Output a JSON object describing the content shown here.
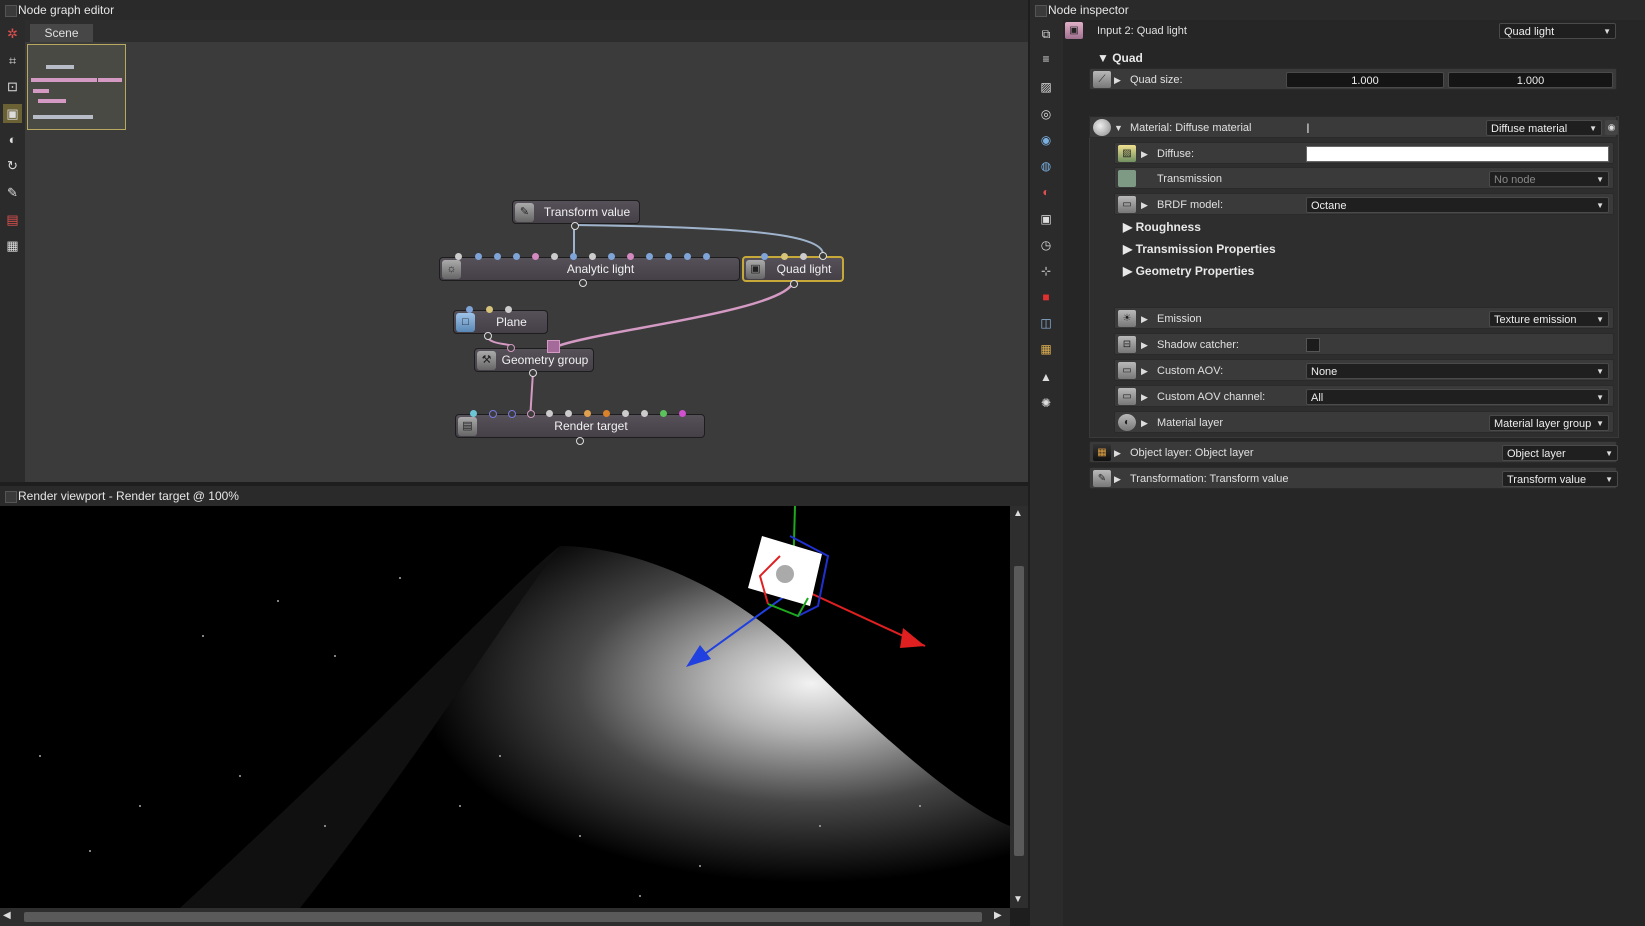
{
  "node_graph": {
    "title": "Node graph editor",
    "tab": "Scene",
    "nodes": {
      "transform_value": "Transform value",
      "analytic_light": "Analytic light",
      "quad_light": "Quad light",
      "plane": "Plane",
      "geometry_group": "Geometry group",
      "render_target": "Render target"
    }
  },
  "viewport": {
    "title": "Render viewport - Render target @ 100%"
  },
  "inspector": {
    "title": "Node inspector",
    "input_label": "Input 2: Quad light",
    "input_value": "Quad light",
    "quad_section": "Quad",
    "quad_size_label": "Quad size:",
    "quad_size_x": "1.000",
    "quad_size_y": "1.000",
    "material_label": "Material: Diffuse material",
    "material_value": "Diffuse material",
    "diffuse_label": "Diffuse:",
    "diffuse_color": "#ffffff",
    "transmission_label": "Transmission",
    "transmission_value": "No node",
    "brdf_label": "BRDF model:",
    "brdf_value": "Octane",
    "roughness_section": "Roughness",
    "transmission_props_section": "Transmission Properties",
    "geometry_props_section": "Geometry Properties",
    "emission_label": "Emission",
    "emission_value": "Texture emission",
    "shadow_catcher_label": "Shadow catcher:",
    "shadow_catcher_checked": false,
    "custom_aov_label": "Custom AOV:",
    "custom_aov_value": "None",
    "custom_aov_channel_label": "Custom AOV channel:",
    "custom_aov_channel_value": "All",
    "material_layer_label": "Material layer",
    "material_layer_value": "Material layer group",
    "object_layer_label": "Object layer: Object layer",
    "object_layer_value": "Object layer",
    "transformation_label": "Transformation: Transform value",
    "transformation_value": "Transform value"
  }
}
